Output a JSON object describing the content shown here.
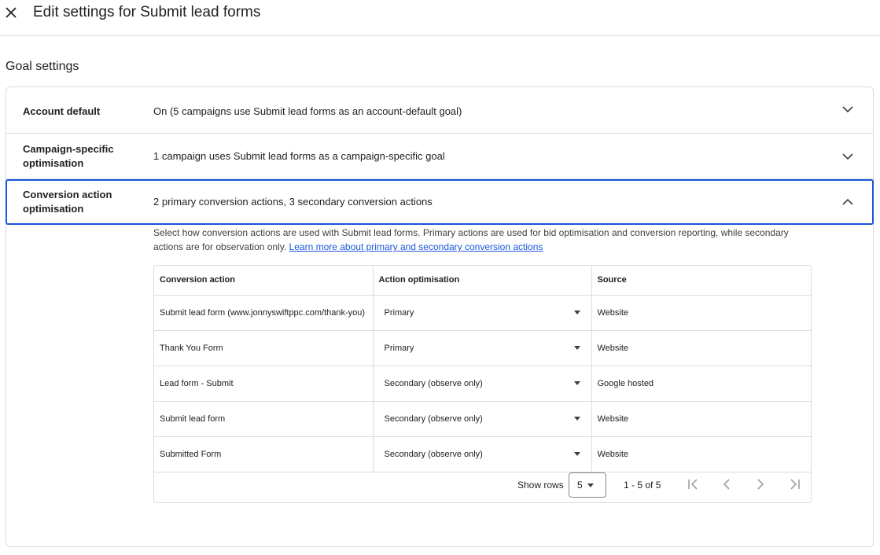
{
  "header": {
    "title": "Edit settings for Submit lead forms"
  },
  "section": {
    "title": "Goal settings"
  },
  "rows": [
    {
      "label": "Account default",
      "value": "On (5 campaigns use Submit lead forms as an account-default goal)",
      "expanded": false
    },
    {
      "label": "Campaign-specific optimisation",
      "value": "1 campaign uses Submit lead forms as a campaign-specific goal",
      "expanded": false
    },
    {
      "label": "Conversion action optimisation",
      "value": "2 primary conversion actions, 3 secondary conversion actions",
      "expanded": true
    }
  ],
  "description": {
    "text": "Select how conversion actions are used with Submit lead forms. Primary actions are used for bid optimisation and conversion reporting, while secondary actions are for observation only.",
    "link": "Learn more about primary and secondary conversion actions"
  },
  "table": {
    "headers": [
      "Conversion action",
      "Action optimisation",
      "Source"
    ],
    "rows": [
      {
        "action": "Submit lead form (www.jonnyswiftppc.com/thank-you)",
        "optimisation": "Primary",
        "source": "Website"
      },
      {
        "action": "Thank You Form",
        "optimisation": "Primary",
        "source": "Website"
      },
      {
        "action": "Lead form - Submit",
        "optimisation": "Secondary (observe only)",
        "source": "Google hosted"
      },
      {
        "action": "Submit lead form",
        "optimisation": "Secondary (observe only)",
        "source": "Website"
      },
      {
        "action": "Submitted Form",
        "optimisation": "Secondary (observe only)",
        "source": "Website"
      }
    ]
  },
  "pager": {
    "show_rows_label": "Show rows",
    "rows_value": "5",
    "range": "1 - 5 of 5"
  },
  "colors": {
    "accent": "#1a56db",
    "border": "#dadce0",
    "icon": "#5f6368",
    "icon_disabled": "#9aa0a6"
  }
}
